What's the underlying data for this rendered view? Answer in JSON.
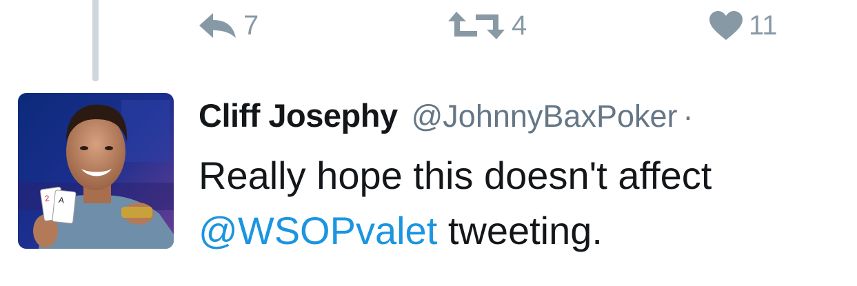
{
  "actions": {
    "reply_count": "7",
    "retweet_count": "4",
    "like_count": "11",
    "icon_color": "#8899a6"
  },
  "tweet": {
    "display_name": "Cliff Josephy",
    "handle": "@JohnnyBaxPoker",
    "separator": "·",
    "text_part1": "Really hope this doesn't affect ",
    "mention": "@WSOPvalet",
    "text_part2": " tweeting.",
    "mention_color": "#1b95e0"
  },
  "avatar": {
    "icon": "profile-photo",
    "cards_visible": [
      "2",
      "A"
    ]
  }
}
